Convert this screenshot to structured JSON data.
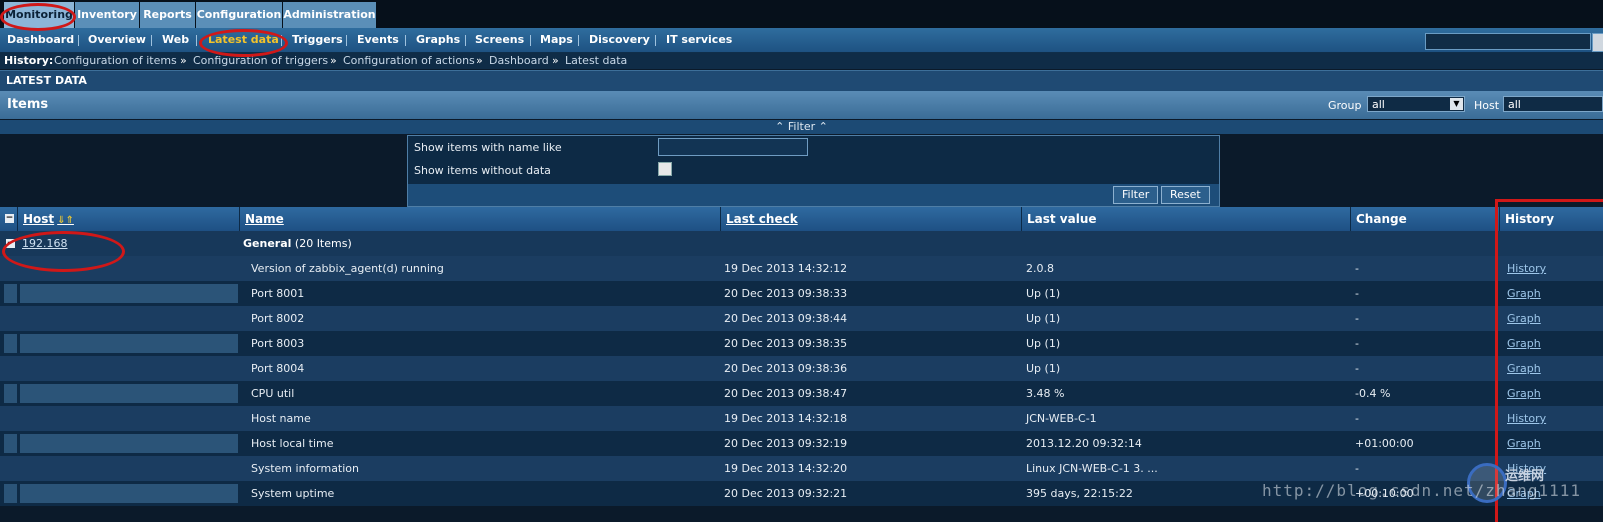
{
  "main_tabs": [
    "Monitoring",
    "Inventory",
    "Reports",
    "Configuration",
    "Administration"
  ],
  "sub_nav": [
    "Dashboard",
    "Overview",
    "Web",
    "Latest data",
    "Triggers",
    "Events",
    "Graphs",
    "Screens",
    "Maps",
    "Discovery",
    "IT services"
  ],
  "history": {
    "label": "History:",
    "links": [
      "Configuration of items",
      "Configuration of triggers",
      "Configuration of actions",
      "Dashboard",
      "Latest data"
    ],
    "separator": "»"
  },
  "section_title": "LATEST DATA",
  "items_bar": {
    "title": "Items",
    "group_label": "Group",
    "group_value": "all",
    "host_label": "Host",
    "host_value": "all"
  },
  "filter": {
    "toggle": "⌃ Filter ⌃",
    "name_like_label": "Show items with name like",
    "without_data_label": "Show items without data",
    "filter_button": "Filter",
    "reset_button": "Reset"
  },
  "table": {
    "headers": [
      "Host",
      "Name",
      "Last check",
      "Last value",
      "Change",
      "History"
    ],
    "group_host": "192.168",
    "group_name": "General",
    "group_count": "(20 Items)",
    "rows": [
      {
        "name": "Version of zabbix_agent(d) running",
        "last_check": "19 Dec 2013 14:32:12",
        "last_value": "2.0.8",
        "change": "-",
        "history": "History"
      },
      {
        "name": "Port 8001",
        "last_check": "20 Dec 2013 09:38:33",
        "last_value": "Up (1)",
        "change": "-",
        "history": "Graph"
      },
      {
        "name": "Port 8002",
        "last_check": "20 Dec 2013 09:38:44",
        "last_value": "Up (1)",
        "change": "-",
        "history": "Graph"
      },
      {
        "name": "Port 8003",
        "last_check": "20 Dec 2013 09:38:35",
        "last_value": "Up (1)",
        "change": "-",
        "history": "Graph"
      },
      {
        "name": "Port 8004",
        "last_check": "20 Dec 2013 09:38:36",
        "last_value": "Up (1)",
        "change": "-",
        "history": "Graph"
      },
      {
        "name": "CPU util",
        "last_check": "20 Dec 2013 09:38:47",
        "last_value": "3.48 %",
        "change": "-0.4 %",
        "history": "Graph"
      },
      {
        "name": "Host name",
        "last_check": "19 Dec 2013 14:32:18",
        "last_value": "JCN-WEB-C-1",
        "change": "-",
        "history": "History"
      },
      {
        "name": "Host local time",
        "last_check": "20 Dec 2013 09:32:19",
        "last_value": "2013.12.20 09:32:14",
        "change": "+01:00:00",
        "history": "Graph"
      },
      {
        "name": "System information",
        "last_check": "19 Dec 2013 14:32:20",
        "last_value": "Linux JCN-WEB-C-1 3. ...",
        "change": "-",
        "history": "History"
      },
      {
        "name": "System uptime",
        "last_check": "20 Dec 2013 09:32:21",
        "last_value": "395 days, 22:15:22",
        "change": "+00:10:00",
        "history": "Graph"
      }
    ]
  },
  "watermark": {
    "url": "http://blog.csdn.net/zhang1111",
    "brand": "运维网"
  },
  "colors": {
    "background": "#0b1a2a",
    "active_sub_nav": "#f3c32a",
    "annotation": "#d01818"
  }
}
